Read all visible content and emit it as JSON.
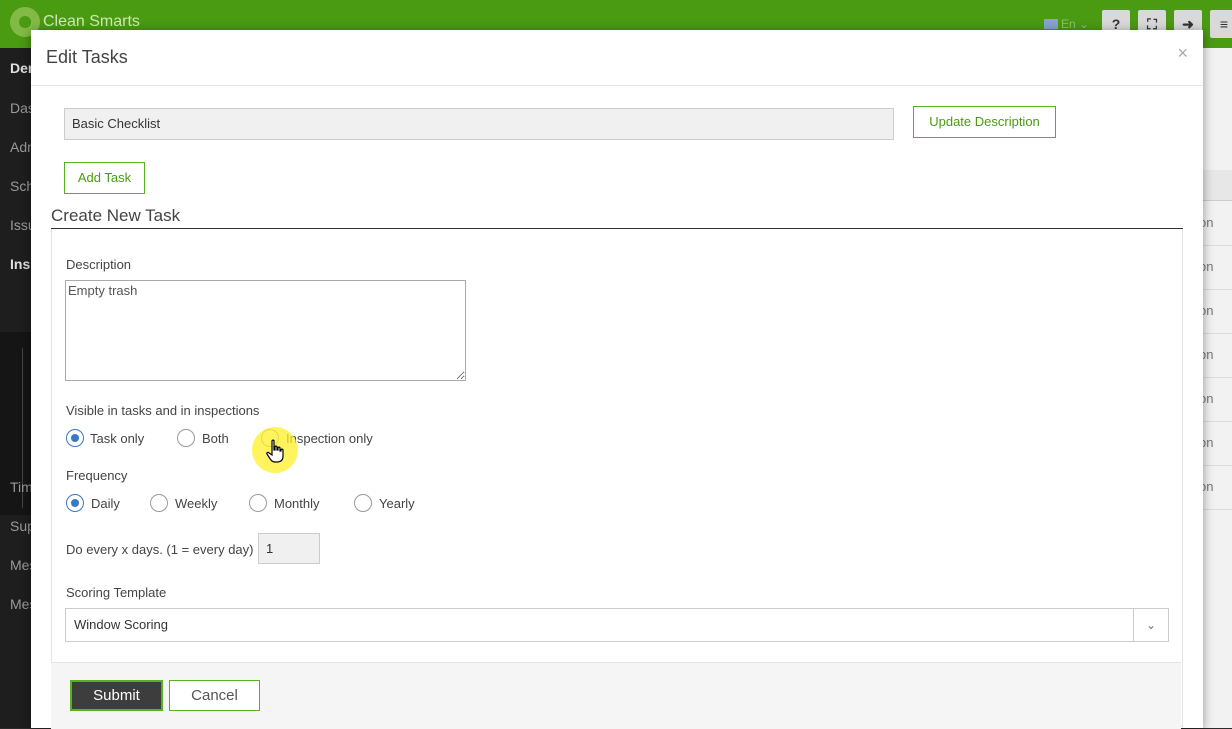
{
  "app": {
    "brand": "Clean Smarts",
    "language": "En",
    "toolbar": {
      "help": "?",
      "fullscreen": "⛶",
      "logout": "➜",
      "menu": "≡"
    },
    "sidebar_items": [
      "Dem",
      "Das",
      "Adm",
      "Sch",
      "Issu",
      "Insp",
      "Tim",
      "Sup",
      "Mes",
      "Mes"
    ],
    "right_rows": [
      "on",
      "on",
      "on",
      "on",
      "on",
      "on",
      "on"
    ]
  },
  "modal": {
    "title": "Edit Tasks",
    "close": "×",
    "checklist_name": "Basic Checklist",
    "update_button": "Update Description",
    "add_task_button": "Add Task",
    "section_title": "Create New Task",
    "description_label": "Description",
    "description_value": "Empty trash",
    "visibility": {
      "label": "Visible in tasks and in inspections",
      "options": [
        "Task only",
        "Both",
        "Inspection only"
      ],
      "selected": "Task only"
    },
    "frequency": {
      "label": "Frequency",
      "options": [
        "Daily",
        "Weekly",
        "Monthly",
        "Yearly"
      ],
      "selected": "Daily"
    },
    "every_x_days_label": "Do every x days. (1 = every day)",
    "every_x_days_value": "1",
    "scoring": {
      "label": "Scoring Template",
      "value": "Window Scoring"
    },
    "submit_button": "Submit",
    "cancel_button": "Cancel"
  },
  "colors": {
    "brand_green": "#4a9a12",
    "accent_blue": "#3a78c4",
    "cursor_highlight": "#fff028"
  }
}
